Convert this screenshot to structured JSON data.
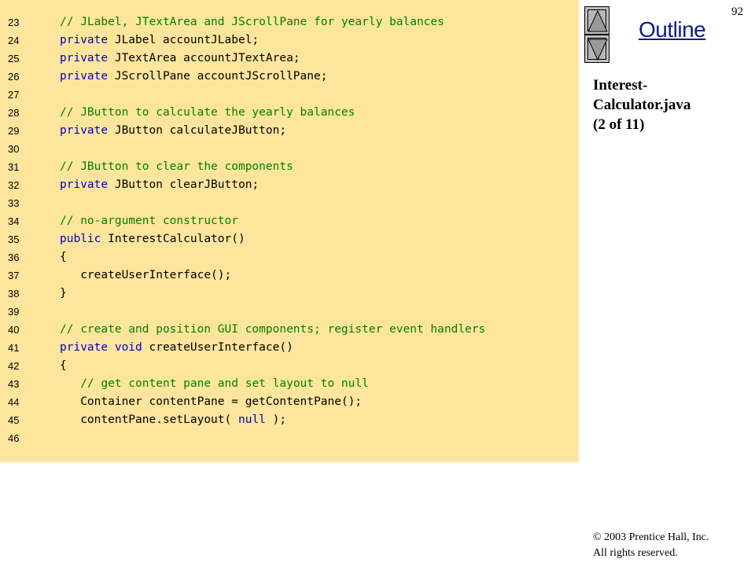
{
  "slide": {
    "page_number": "92",
    "outline_label": "Outline",
    "file_label_line1": "Interest-",
    "file_label_line2": "Calculator.java",
    "file_label_line3": "(2 of 11)",
    "copyright_line1": "© 2003 Prentice Hall, Inc.",
    "copyright_line2": "All rights reserved."
  },
  "colors": {
    "code_background": "#fde59d",
    "comment": "#008000",
    "keyword": "#0000c8",
    "outline": "#0e1b8a"
  },
  "icons": {
    "up": "triangle-up-icon",
    "down": "triangle-down-icon"
  },
  "code_lines": [
    {
      "num": "23",
      "tokens": [
        {
          "t": "comment",
          "s": "// JLabel, JTextArea and JScrollPane for yearly balances"
        }
      ]
    },
    {
      "num": "24",
      "tokens": [
        {
          "t": "keyword",
          "s": "private"
        },
        {
          "t": "plain",
          "s": " JLabel accountJLabel;"
        }
      ]
    },
    {
      "num": "25",
      "tokens": [
        {
          "t": "keyword",
          "s": "private"
        },
        {
          "t": "plain",
          "s": " JTextArea accountJTextArea;"
        }
      ]
    },
    {
      "num": "26",
      "tokens": [
        {
          "t": "keyword",
          "s": "private"
        },
        {
          "t": "plain",
          "s": " JScrollPane accountJScrollPane;"
        }
      ]
    },
    {
      "num": "27",
      "tokens": []
    },
    {
      "num": "28",
      "tokens": [
        {
          "t": "comment",
          "s": "// JButton to calculate the yearly balances"
        }
      ]
    },
    {
      "num": "29",
      "tokens": [
        {
          "t": "keyword",
          "s": "private"
        },
        {
          "t": "plain",
          "s": " JButton calculateJButton;"
        }
      ]
    },
    {
      "num": "30",
      "tokens": []
    },
    {
      "num": "31",
      "tokens": [
        {
          "t": "comment",
          "s": "// JButton to clear the components"
        }
      ]
    },
    {
      "num": "32",
      "tokens": [
        {
          "t": "keyword",
          "s": "private"
        },
        {
          "t": "plain",
          "s": " JButton clearJButton;"
        }
      ]
    },
    {
      "num": "33",
      "tokens": []
    },
    {
      "num": "34",
      "tokens": [
        {
          "t": "comment",
          "s": "// no-argument constructor"
        }
      ]
    },
    {
      "num": "35",
      "tokens": [
        {
          "t": "keyword",
          "s": "public"
        },
        {
          "t": "plain",
          "s": " InterestCalculator()"
        }
      ]
    },
    {
      "num": "36",
      "tokens": [
        {
          "t": "plain",
          "s": "{"
        }
      ]
    },
    {
      "num": "37",
      "tokens": [
        {
          "t": "plain",
          "s": "   createUserInterface();"
        }
      ]
    },
    {
      "num": "38",
      "tokens": [
        {
          "t": "plain",
          "s": "}"
        }
      ]
    },
    {
      "num": "39",
      "tokens": []
    },
    {
      "num": "40",
      "tokens": [
        {
          "t": "comment",
          "s": "// create and position GUI components; register event handlers"
        }
      ]
    },
    {
      "num": "41",
      "tokens": [
        {
          "t": "keyword",
          "s": "private void"
        },
        {
          "t": "plain",
          "s": " createUserInterface()"
        }
      ]
    },
    {
      "num": "42",
      "tokens": [
        {
          "t": "plain",
          "s": "{"
        }
      ]
    },
    {
      "num": "43",
      "tokens": [
        {
          "t": "plain",
          "s": "   "
        },
        {
          "t": "comment",
          "s": "// get content pane and set layout to null"
        }
      ]
    },
    {
      "num": "44",
      "tokens": [
        {
          "t": "plain",
          "s": "   Container contentPane = getContentPane();"
        }
      ]
    },
    {
      "num": "45",
      "tokens": [
        {
          "t": "plain",
          "s": "   contentPane.setLayout( "
        },
        {
          "t": "keyword",
          "s": "null"
        },
        {
          "t": "plain",
          "s": " );"
        }
      ]
    },
    {
      "num": "46",
      "tokens": []
    }
  ]
}
